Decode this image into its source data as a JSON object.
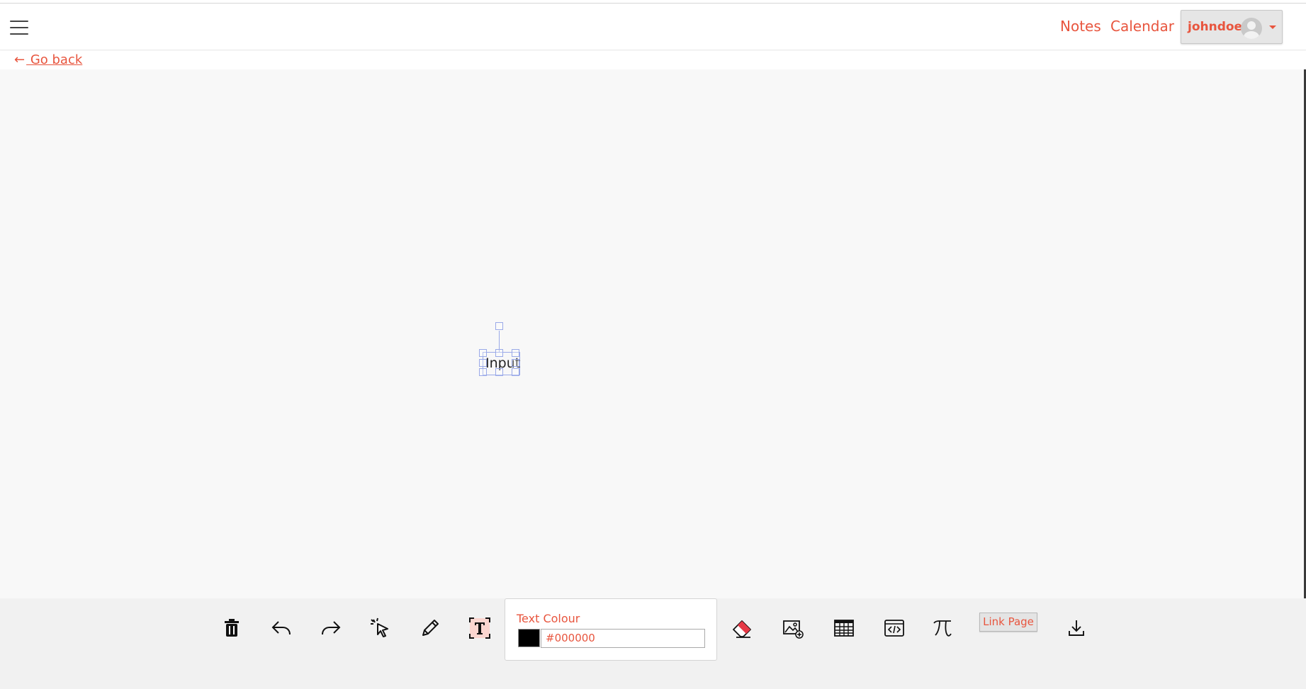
{
  "navbar": {
    "menu_icon": "hamburger-menu-icon",
    "links": {
      "notes": "Notes",
      "calendar": "Calendar"
    },
    "user": {
      "name": "johndoe",
      "avatar_icon": "user-avatar-icon",
      "caret_icon": "caret-down-icon"
    }
  },
  "back": {
    "arrow": "←",
    "label": " Go back"
  },
  "canvas": {
    "text_object": {
      "text": "Input"
    }
  },
  "toolbar": {
    "tools": [
      {
        "name": "delete",
        "icon": "trash-icon"
      },
      {
        "name": "undo",
        "icon": "undo-icon"
      },
      {
        "name": "redo",
        "icon": "redo-icon"
      },
      {
        "name": "select",
        "icon": "select-cursor-icon"
      },
      {
        "name": "pen",
        "icon": "pencil-icon"
      },
      {
        "name": "text",
        "icon": "text-tool-icon",
        "active": true
      },
      {
        "name": "eraser",
        "icon": "eraser-icon"
      },
      {
        "name": "image",
        "icon": "add-image-icon"
      },
      {
        "name": "table",
        "icon": "table-icon"
      },
      {
        "name": "code",
        "icon": "code-block-icon"
      },
      {
        "name": "math",
        "icon": "pi-math-icon"
      },
      {
        "name": "download",
        "icon": "download-icon"
      }
    ],
    "text_colour": {
      "label": "Text Colour",
      "value": "#000000"
    },
    "link_page_label": "Link Page"
  },
  "colors": {
    "accent": "#e8553e",
    "canvas_bg": "#f8f8f8",
    "selection": "#9aa9e8"
  }
}
